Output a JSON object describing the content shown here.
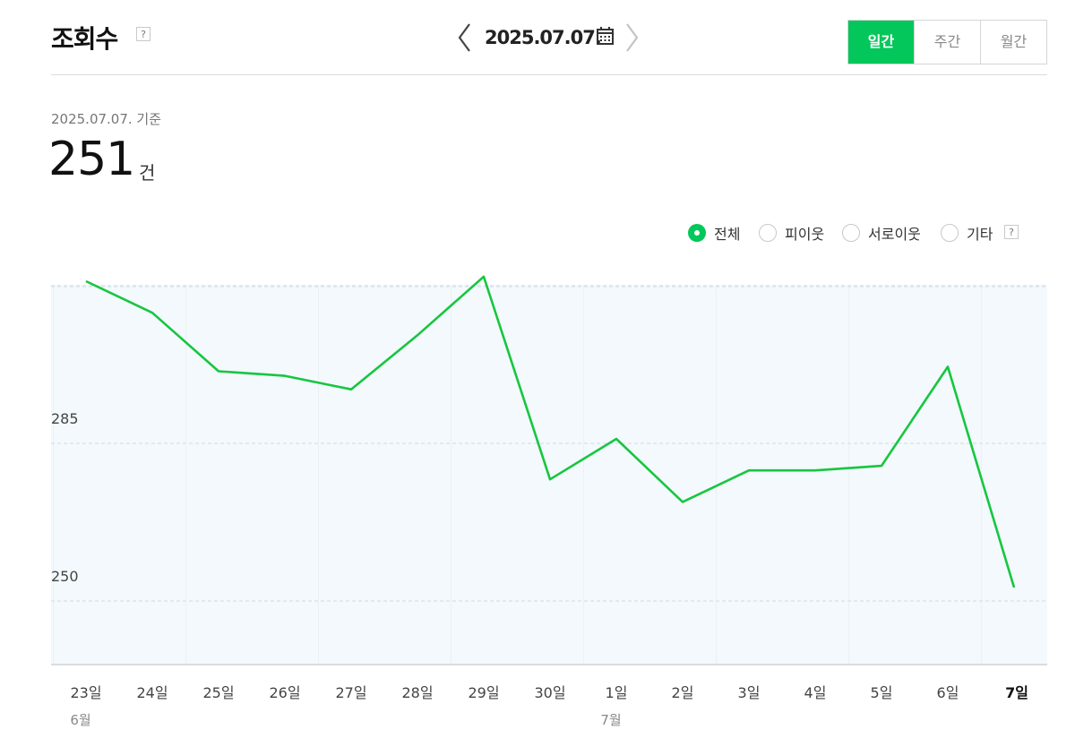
{
  "header": {
    "title": "조회수",
    "help": "?",
    "date": "2025.07.07.",
    "periods": [
      {
        "label": "일간",
        "active": true
      },
      {
        "label": "주간",
        "active": false
      },
      {
        "label": "월간",
        "active": false
      }
    ]
  },
  "summary": {
    "basis": "2025.07.07. 기준",
    "value": "251",
    "unit": "건"
  },
  "filters": [
    {
      "label": "전체",
      "selected": true
    },
    {
      "label": "피이웃",
      "selected": false
    },
    {
      "label": "서로이웃",
      "selected": false
    },
    {
      "label": "기타",
      "selected": false
    }
  ],
  "filter_help": "?",
  "colors": {
    "accent": "#03c75a",
    "line": "#17c640",
    "plot_bg": "#f3f9fc",
    "grid": "#dde5e9"
  },
  "chart_data": {
    "type": "line",
    "x": [
      "23일",
      "24일",
      "25일",
      "26일",
      "27일",
      "28일",
      "29일",
      "30일",
      "1일",
      "2일",
      "3일",
      "4일",
      "5일",
      "6일",
      "7일"
    ],
    "month_labels": [
      {
        "at": "23일",
        "label": "6월"
      },
      {
        "at": "1일",
        "label": "7월"
      }
    ],
    "highlight_x": "7일",
    "series": [
      {
        "values": [
          321,
          314,
          301,
          300,
          297,
          309,
          322,
          277,
          286,
          272,
          279,
          279,
          280,
          302,
          253
        ]
      }
    ],
    "yticks": [
      250,
      285,
      320
    ],
    "ylim": [
      236,
      324
    ],
    "grid": true,
    "title": "",
    "xlabel": "",
    "ylabel": ""
  }
}
